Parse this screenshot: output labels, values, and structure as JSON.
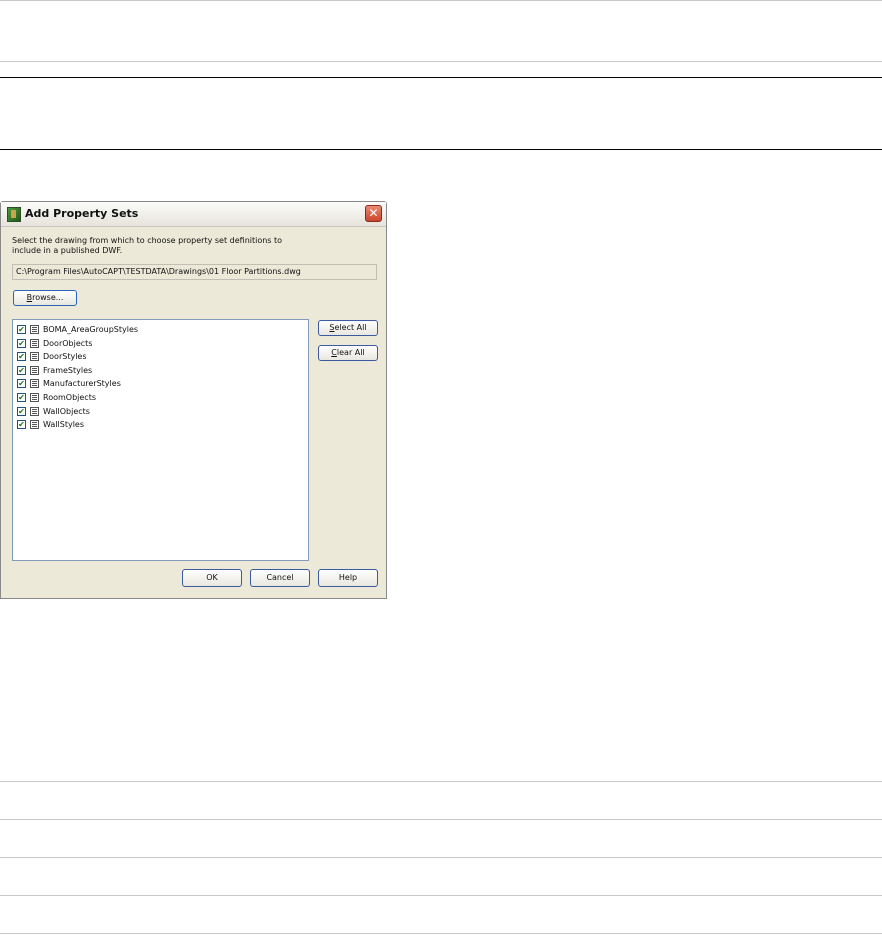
{
  "dialog": {
    "title": "Add Property Sets",
    "close_glyph": "✕",
    "instructions": "Select the drawing from which to choose property set definitions to include in a published DWF.",
    "path": "C:\\Program Files\\AutoCAPT\\TESTDATA\\Drawings\\01 Floor Partitions.dwg",
    "browse": {
      "underline": "B",
      "rest": "rowse..."
    },
    "select_all": {
      "underline": "S",
      "rest": "elect All"
    },
    "clear_all": {
      "underline": "C",
      "rest": "lear All"
    },
    "ok_label": "OK",
    "cancel_label": "Cancel",
    "help_label": "Help",
    "check_glyph": "✔",
    "items": [
      {
        "label": "BOMA_AreaGroupStyles",
        "checked": true
      },
      {
        "label": "DoorObjects",
        "checked": true
      },
      {
        "label": "DoorStyles",
        "checked": true
      },
      {
        "label": "FrameStyles",
        "checked": true
      },
      {
        "label": "ManufacturerStyles",
        "checked": true
      },
      {
        "label": "RoomObjects",
        "checked": true
      },
      {
        "label": "WallObjects",
        "checked": true
      },
      {
        "label": "WallStyles",
        "checked": true
      }
    ]
  }
}
